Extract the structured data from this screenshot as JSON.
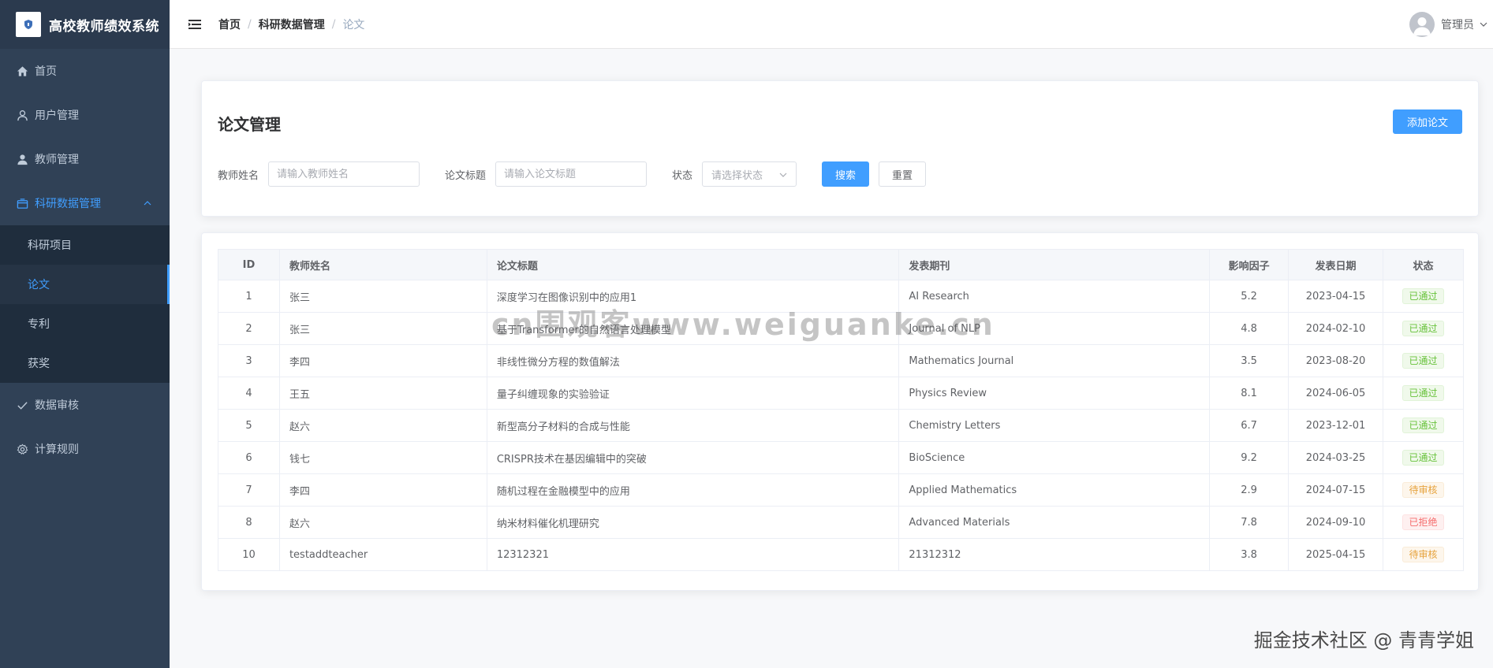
{
  "app": {
    "title": "高校教师绩效系统"
  },
  "sidebar": {
    "items": [
      {
        "label": "首页",
        "icon": "home-icon"
      },
      {
        "label": "用户管理",
        "icon": "user-icon"
      },
      {
        "label": "教师管理",
        "icon": "person-filled-icon"
      },
      {
        "label": "科研数据管理",
        "icon": "box-icon"
      },
      {
        "label": "数据审核",
        "icon": "check-icon"
      },
      {
        "label": "计算规则",
        "icon": "gear-icon"
      }
    ],
    "sub_items": [
      {
        "label": "科研项目"
      },
      {
        "label": "论文"
      },
      {
        "label": "专利"
      },
      {
        "label": "获奖"
      }
    ]
  },
  "header": {
    "breadcrumb": [
      "首页",
      "科研数据管理",
      "论文"
    ],
    "separator": "/",
    "user_name": "管理员"
  },
  "search": {
    "title": "论文管理",
    "add_button": "添加论文",
    "teacher_label": "教师姓名",
    "teacher_placeholder": "请输入教师姓名",
    "paper_label": "论文标题",
    "paper_placeholder": "请输入论文标题",
    "status_label": "状态",
    "status_placeholder": "请选择状态",
    "search_button": "搜索",
    "reset_button": "重置"
  },
  "table": {
    "headers": [
      "ID",
      "教师姓名",
      "论文标题",
      "发表期刊",
      "影响因子",
      "发表日期",
      "状态"
    ],
    "rows": [
      {
        "id": "1",
        "teacher": "张三",
        "title": "深度学习在图像识别中的应用1",
        "journal": "AI Research",
        "factor": "5.2",
        "date": "2023-04-15",
        "status": "已通过",
        "status_type": "success"
      },
      {
        "id": "2",
        "teacher": "张三",
        "title": "基于Transformer的自然语言处理模型",
        "journal": "Journal of NLP",
        "factor": "4.8",
        "date": "2024-02-10",
        "status": "已通过",
        "status_type": "success"
      },
      {
        "id": "3",
        "teacher": "李四",
        "title": "非线性微分方程的数值解法",
        "journal": "Mathematics Journal",
        "factor": "3.5",
        "date": "2023-08-20",
        "status": "已通过",
        "status_type": "success"
      },
      {
        "id": "4",
        "teacher": "王五",
        "title": "量子纠缠现象的实验验证",
        "journal": "Physics Review",
        "factor": "8.1",
        "date": "2024-06-05",
        "status": "已通过",
        "status_type": "success"
      },
      {
        "id": "5",
        "teacher": "赵六",
        "title": "新型高分子材料的合成与性能",
        "journal": "Chemistry Letters",
        "factor": "6.7",
        "date": "2023-12-01",
        "status": "已通过",
        "status_type": "success"
      },
      {
        "id": "6",
        "teacher": "钱七",
        "title": "CRISPR技术在基因编辑中的突破",
        "journal": "BioScience",
        "factor": "9.2",
        "date": "2024-03-25",
        "status": "已通过",
        "status_type": "success"
      },
      {
        "id": "7",
        "teacher": "李四",
        "title": "随机过程在金融模型中的应用",
        "journal": "Applied Mathematics",
        "factor": "2.9",
        "date": "2024-07-15",
        "status": "待审核",
        "status_type": "warning"
      },
      {
        "id": "8",
        "teacher": "赵六",
        "title": "纳米材料催化机理研究",
        "journal": "Advanced Materials",
        "factor": "7.8",
        "date": "2024-09-10",
        "status": "已拒绝",
        "status_type": "danger"
      },
      {
        "id": "10",
        "teacher": "testaddteacher",
        "title": "12312321",
        "journal": "21312312",
        "factor": "3.8",
        "date": "2025-04-15",
        "status": "待审核",
        "status_type": "warning"
      }
    ]
  },
  "watermarks": {
    "center": "cn围观客www.weiguanke.cn",
    "corner": "掘金技术社区 @ 青青学姐"
  },
  "colors": {
    "sidebar_bg": "#304156",
    "accent": "#409eff",
    "success": "#67c23a",
    "warning": "#e6a23c",
    "danger": "#f56c6c"
  }
}
